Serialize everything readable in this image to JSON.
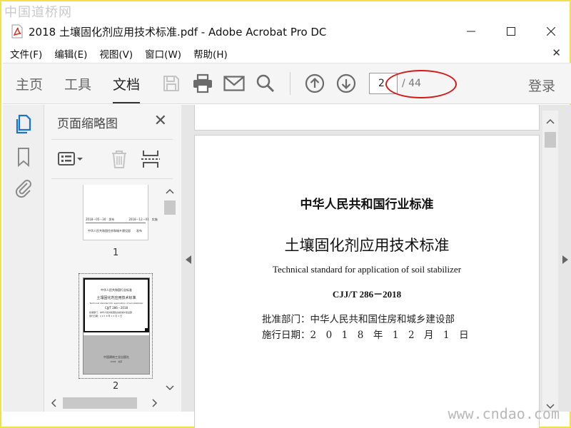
{
  "watermarks": {
    "top": "中国道桥网",
    "bottom": "www.cndao.com"
  },
  "window": {
    "title": "2018 土壤固化剂应用技术标准.pdf - Adobe Acrobat Pro DC"
  },
  "menu": {
    "items": [
      "文件(F)",
      "编辑(E)",
      "视图(V)",
      "窗口(W)",
      "帮助(H)"
    ]
  },
  "toolbar": {
    "tabs": [
      "主页",
      "工具",
      "文档"
    ],
    "active_tab": "文档",
    "page_current": "2",
    "page_total": "/ 44",
    "login_label": "登录"
  },
  "thumbnail_panel": {
    "title": "页面缩略图",
    "thumbnails": [
      {
        "label": "1",
        "line1": "2018－05－30　发布　　　　　2018－12－01　实施",
        "line2": "中华人民共和国住房和城乡建设部　　发布"
      },
      {
        "label": "2",
        "line1": "中华人民共和国行业标准",
        "line2": "土壤固化剂应用技术标准",
        "line3": "Technical standard for application of soil stabilizer",
        "line4": "CJJ/T 286－2018",
        "line5": "批准部门：中华人民共和国住房和城乡建设部",
        "line6": "施行日期：2 0 1 8 年 1 2 月 1 日",
        "line7": "中国建筑工业出版社",
        "line8": "2018　北京"
      }
    ]
  },
  "document": {
    "header": "中华人民共和国行业标准",
    "title": "土壤固化剂应用技术标准",
    "english_title": "Technical standard for application of soil stabilizer",
    "code": "CJJ/T 286－2018",
    "approval": "批准部门：中华人民共和国住房和城乡建设部",
    "effective": "施行日期：2　0　1　8　年　1　2　月　1　日"
  },
  "colors": {
    "frame": "#f2e24a",
    "highlight_ellipse": "#d21919",
    "acrobat_red": "#d7261b",
    "icon_gray": "#6b6b6b",
    "icon_disabled": "#c4c4c4",
    "nav_active_icon": "#1a73c7"
  }
}
